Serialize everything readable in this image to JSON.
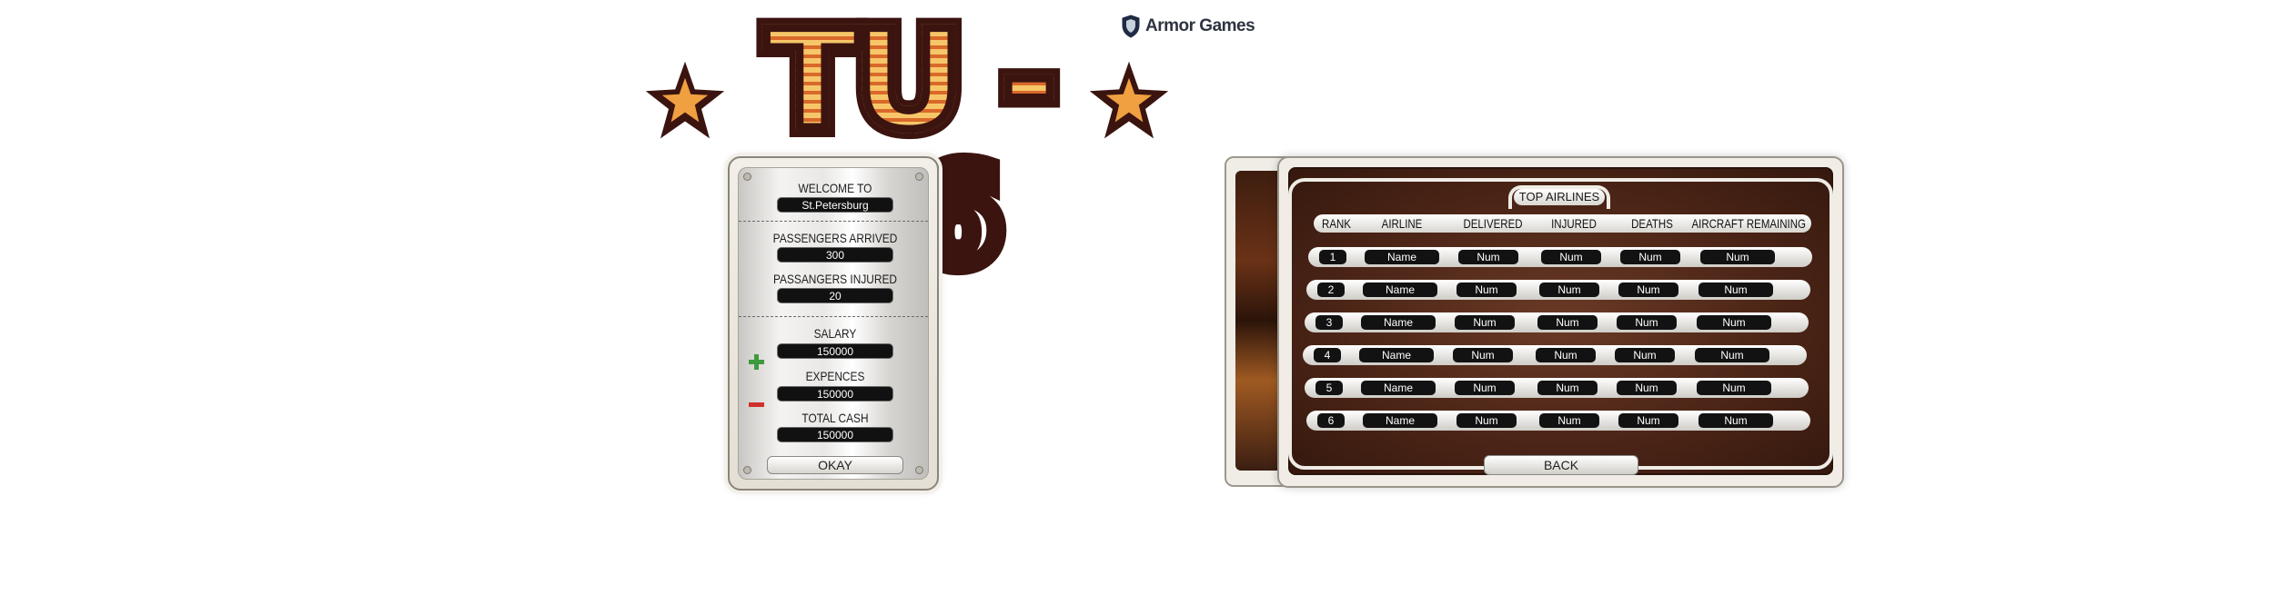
{
  "logo": {
    "title": "TU - 46"
  },
  "brand": {
    "name": "Armor Games",
    "icon": "shield-icon"
  },
  "results": {
    "welcome_label": "WELCOME TO",
    "city": "St.Petersburg",
    "passengers_arrived_label": "PASSENGERS ARRIVED",
    "passengers_arrived": "300",
    "passengers_injured_label": "PASSANGERS INJURED",
    "passengers_injured": "20",
    "salary_label": "SALARY",
    "salary": "150000",
    "expenses_label": "EXPENCES",
    "expenses": "150000",
    "total_cash_label": "TOTAL CASH",
    "total_cash": "150000",
    "okay_label": "OKAY"
  },
  "leaderboard": {
    "title": "TOP AIRLINES",
    "columns": [
      "RANK",
      "AIRLINE",
      "DELIVERED",
      "INJURED",
      "DEATHS",
      "AIRCRAFT REMAINING"
    ],
    "rows": [
      {
        "rank": "1",
        "airline": "Name",
        "delivered": "Num",
        "injured": "Num",
        "deaths": "Num",
        "remaining": "Num"
      },
      {
        "rank": "2",
        "airline": "Name",
        "delivered": "Num",
        "injured": "Num",
        "deaths": "Num",
        "remaining": "Num"
      },
      {
        "rank": "3",
        "airline": "Name",
        "delivered": "Num",
        "injured": "Num",
        "deaths": "Num",
        "remaining": "Num"
      },
      {
        "rank": "4",
        "airline": "Name",
        "delivered": "Num",
        "injured": "Num",
        "deaths": "Num",
        "remaining": "Num"
      },
      {
        "rank": "5",
        "airline": "Name",
        "delivered": "Num",
        "injured": "Num",
        "deaths": "Num",
        "remaining": "Num"
      },
      {
        "rank": "6",
        "airline": "Name",
        "delivered": "Num",
        "injured": "Num",
        "deaths": "Num",
        "remaining": "Num"
      }
    ],
    "back_label": "BACK"
  },
  "colors": {
    "logo_outline": "#3b1410",
    "logo_fill_light": "#f7c668",
    "logo_fill_dark": "#d9692a",
    "board_brown": "#4a2416",
    "plus_green": "#3d9a3d",
    "minus_red": "#d0302c"
  }
}
